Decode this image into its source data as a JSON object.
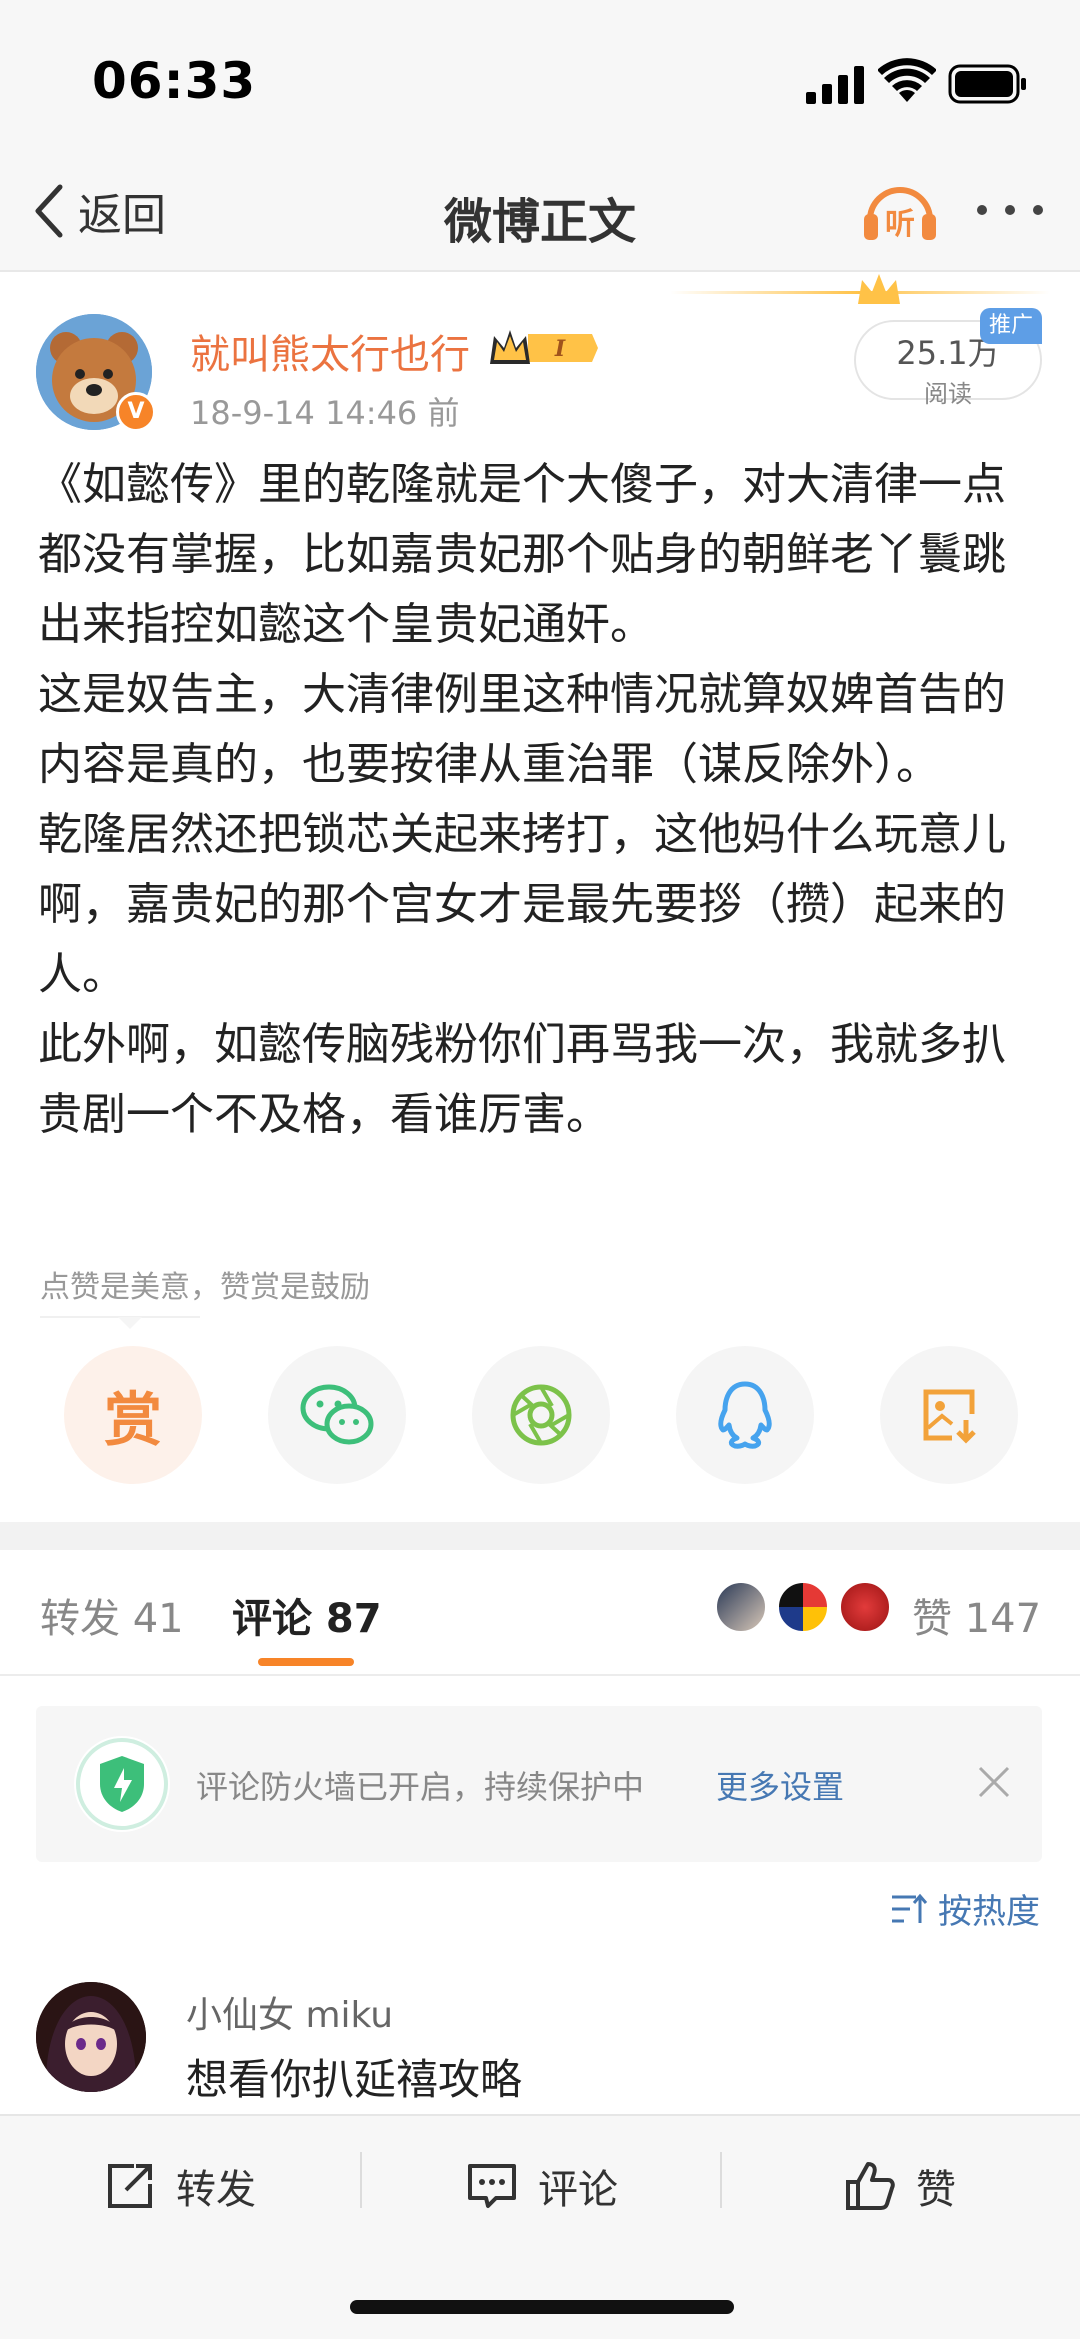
{
  "status_bar": {
    "time": "06:33"
  },
  "nav": {
    "back_label": "返回",
    "title": "微博正文"
  },
  "post": {
    "author": "就叫熊太行也行",
    "level_badge": "I",
    "timestamp": "18-9-14 14:46  前",
    "read_count": "25.1万",
    "read_label": "阅读",
    "promo_tag": "推广",
    "paragraphs": [
      "《如懿传》里的乾隆就是个大傻子，对大清律一点都没有掌握，比如嘉贵妃那个贴身的朝鲜老丫鬟跳出来指控如懿这个皇贵妃通奸。",
      "这是奴告主，大清律例里这种情况就算奴婢首告的内容是真的，也要按律从重治罪（谋反除外）。",
      "乾隆居然还把锁芯关起来拷打，这他妈什么玩意儿啊，嘉贵妃的那个宫女才是最先要拶（攒）起来的人。",
      "此外啊，如懿传脑残粉你们再骂我一次，我就多扒贵剧一个不及格，看谁厉害。"
    ],
    "reward_hint": "点赞是美意，赞赏是鼓励",
    "reward_char": "赏"
  },
  "share_icons": [
    "reward-icon",
    "wechat-icon",
    "moments-icon",
    "qq-icon",
    "save-image-icon"
  ],
  "tabs": {
    "repost": "转发 41",
    "comment": "评论 87",
    "like": "赞 147"
  },
  "firewall": {
    "text": "评论防火墙已开启，持续保护中",
    "link": "更多设置"
  },
  "sort": {
    "label": "按热度"
  },
  "comments": [
    {
      "user": "小仙女 miku",
      "text": "想看你扒延禧攻略"
    }
  ],
  "bottom_bar": {
    "repost": "转发",
    "comment": "评论",
    "like": "赞"
  },
  "colors": {
    "accent_orange": "#f78428",
    "username_orange": "#eb7340",
    "link_blue": "#4678b3",
    "shield_green": "#3dbf7a"
  }
}
